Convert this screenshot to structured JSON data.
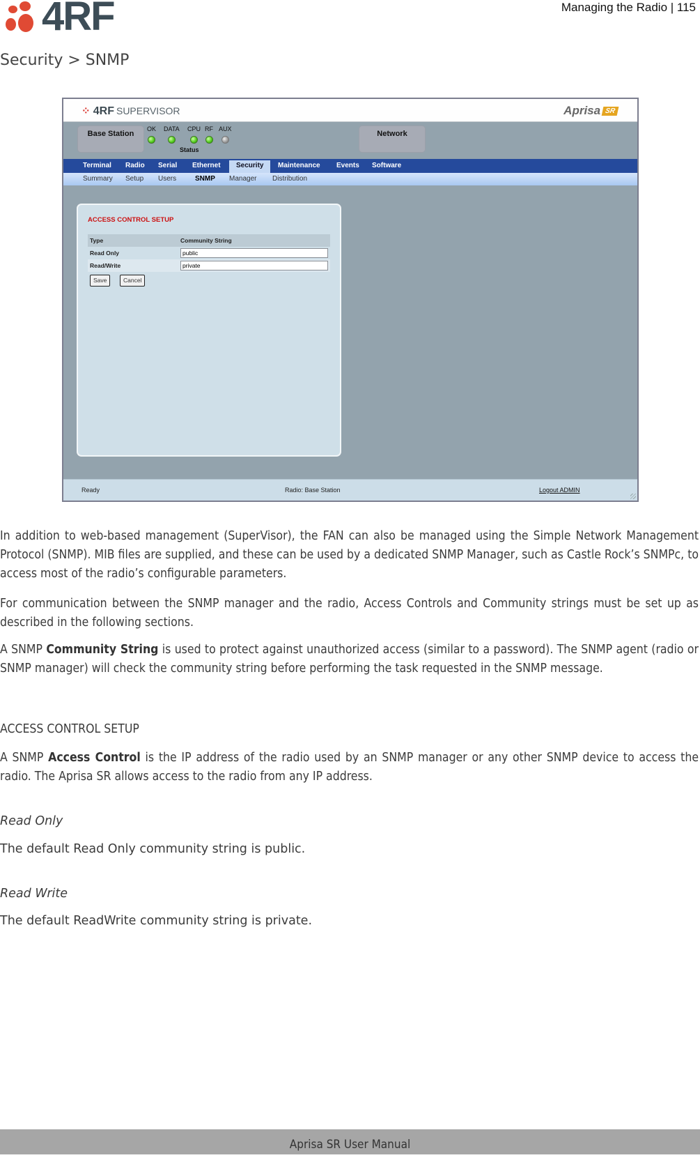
{
  "page_header": {
    "logo_text": "4RF",
    "running_head": "Managing the Radio  |  115"
  },
  "section_title": "Security > SNMP",
  "screenshot": {
    "app_logo": {
      "brand": "4RF",
      "product": "SUPERVISOR"
    },
    "product_logo": {
      "name": "Aprisa",
      "badge": "SR"
    },
    "tiles": {
      "base_station": "Base Station",
      "network": "Network"
    },
    "status_leds": [
      {
        "label": "OK",
        "state": "green"
      },
      {
        "label": "DATA",
        "state": "green"
      },
      {
        "label": "CPU",
        "state": "green"
      },
      {
        "label": "RF",
        "state": "green"
      },
      {
        "label": "AUX",
        "state": "off"
      }
    ],
    "status_label": "Status",
    "nav": [
      "Terminal",
      "Radio",
      "Serial",
      "Ethernet",
      "Security",
      "Maintenance",
      "Events",
      "Software"
    ],
    "nav_active": "Security",
    "subnav": [
      "Summary",
      "Setup",
      "Users",
      "SNMP",
      "Manager",
      "Distribution"
    ],
    "subnav_active": "SNMP",
    "panel": {
      "title": "ACCESS CONTROL SETUP",
      "columns": [
        "Type",
        "Community String"
      ],
      "rows": [
        {
          "type": "Read Only",
          "value": "public"
        },
        {
          "type": "Read/Write",
          "value": "private"
        }
      ],
      "save_label": "Save",
      "cancel_label": "Cancel"
    },
    "statusbar": {
      "state": "Ready",
      "radio": "Radio: Base Station",
      "logout": "Logout ADMIN"
    }
  },
  "body": {
    "p1": "In addition to web-based management (SuperVisor), the FAN can also be managed using the Simple Network Management Protocol (SNMP). MIB files are supplied, and these can be used by a dedicated SNMP Manager, such as Castle Rock’s SNMPc, to access most of the radio’s configurable parameters.",
    "p2": "For communication between the SNMP manager and the radio, Access Controls and Community strings must be set up as described in the following sections.",
    "p3_pre": "A SNMP ",
    "p3_bold": "Community String",
    "p3_post": " is used to protect against unauthorized access (similar to a password). The SNMP agent (radio or SNMP manager) will check the community string before performing the task requested in the SNMP message.",
    "heading_acs": "ACCESS CONTROL SETUP",
    "p4_pre": "A SNMP ",
    "p4_bold": "Access Control",
    "p4_post": " is the IP address of the radio used by an SNMP manager or any other SNMP device to access the radio. The Aprisa SR allows access to the radio from any IP address.",
    "sub_ro": "Read Only",
    "p5": "The default Read Only community string is public.",
    "sub_rw": "Read Write",
    "p6": "The default ReadWrite community string is private."
  },
  "page_footer": "Aprisa SR User Manual"
}
